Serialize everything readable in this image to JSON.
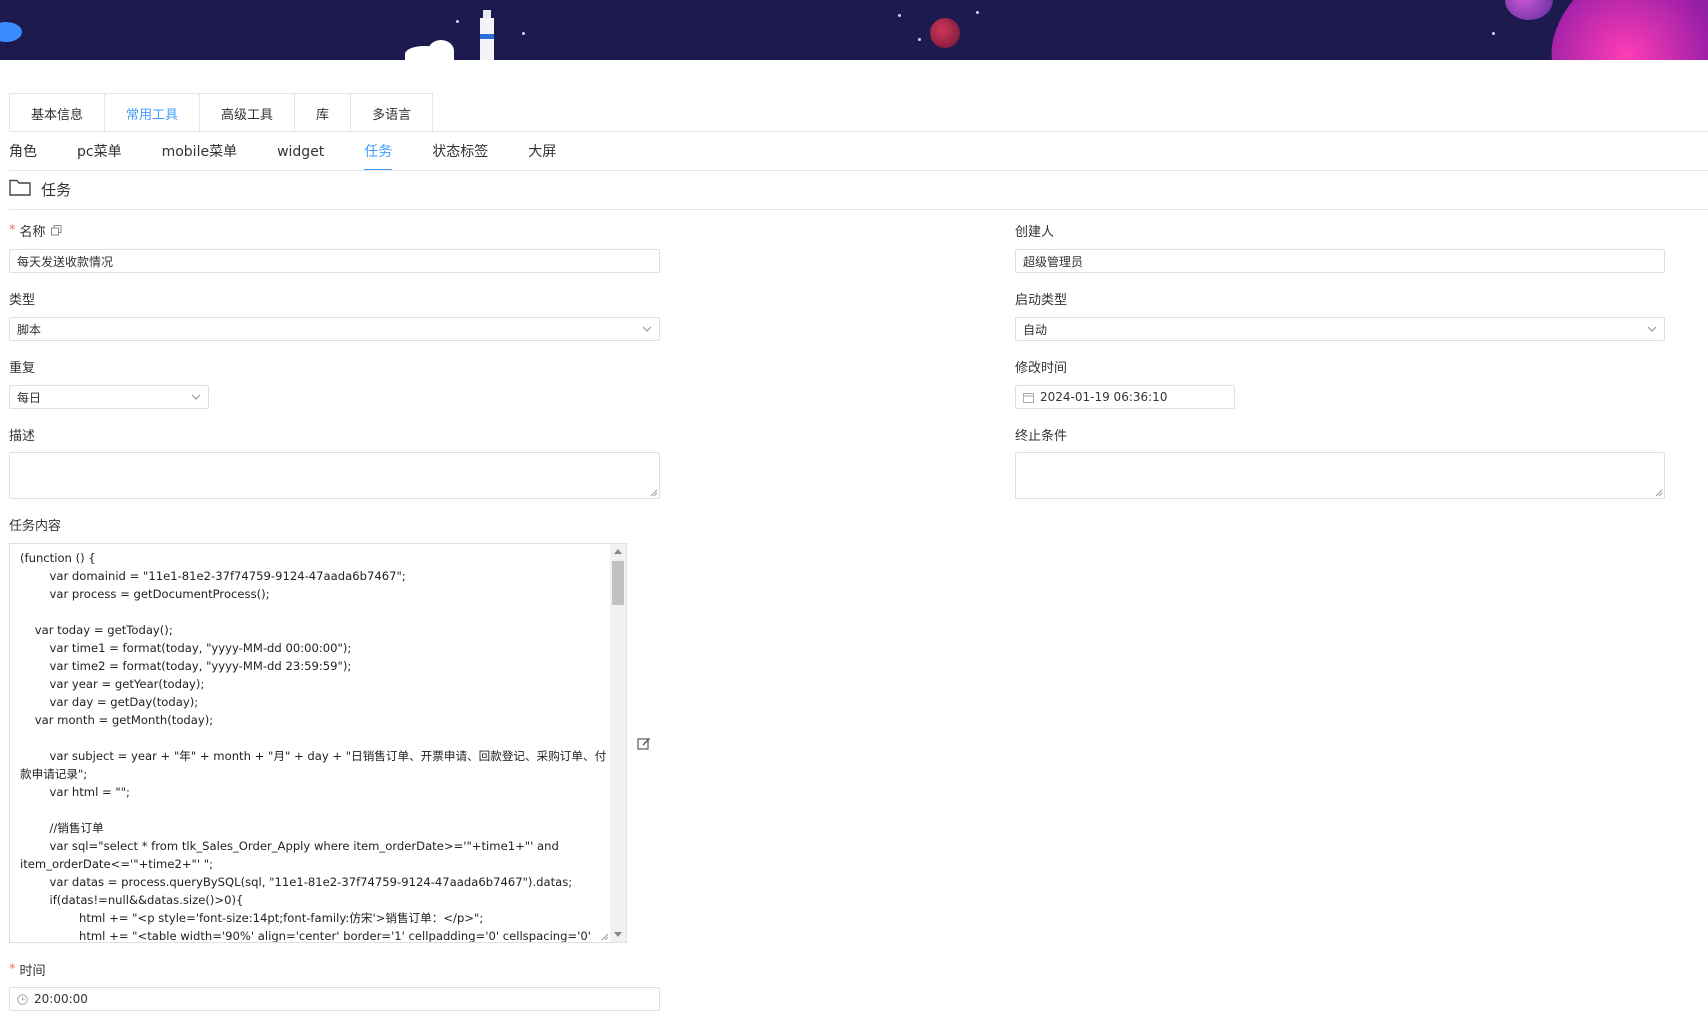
{
  "top_tabs": [
    {
      "label": "基本信息",
      "active": false
    },
    {
      "label": "常用工具",
      "active": true
    },
    {
      "label": "高级工具",
      "active": false
    },
    {
      "label": "库",
      "active": false
    },
    {
      "label": "多语言",
      "active": false
    }
  ],
  "sub_tabs": [
    {
      "label": "角色",
      "active": false
    },
    {
      "label": "pc菜单",
      "active": false
    },
    {
      "label": "mobile菜单",
      "active": false
    },
    {
      "label": "widget",
      "active": false
    },
    {
      "label": "任务",
      "active": true
    },
    {
      "label": "状态标签",
      "active": false
    },
    {
      "label": "大屏",
      "active": false
    }
  ],
  "section": {
    "title": "任务",
    "icon": "folder-icon"
  },
  "form": {
    "name_label": "名称",
    "name_value": "每天发送收款情况",
    "creator_label": "创建人",
    "creator_value": "超级管理员",
    "type_label": "类型",
    "type_value": "脚本",
    "start_type_label": "启动类型",
    "start_type_value": "自动",
    "repeat_label": "重复",
    "repeat_value": "每日",
    "modified_label": "修改时间",
    "modified_value": "2024-01-19 06:36:10",
    "desc_label": "描述",
    "desc_value": "",
    "stop_label": "终止条件",
    "stop_value": "",
    "content_label": "任务内容",
    "content_value": "(function () {\n        var domainid = \"11e1-81e2-37f74759-9124-47aada6b7467\";\n        var process = getDocumentProcess();\n\n    var today = getToday();\n        var time1 = format(today, \"yyyy-MM-dd 00:00:00\");\n        var time2 = format(today, \"yyyy-MM-dd 23:59:59\");\n        var year = getYear(today);\n        var day = getDay(today);\n    var month = getMonth(today);\n\n        var subject = year + \"年\" + month + \"月\" + day + \"日销售订单、开票申请、回款登记、采购订单、付款申请记录\";\n        var html = \"\";\n\n        //销售订单\n        var sql=\"select * from tlk_Sales_Order_Apply where item_orderDate>='\"+time1+\"' and item_orderDate<='\"+time2+\"' \";\n        var datas = process.queryBySQL(sql, \"11e1-81e2-37f74759-9124-47aada6b7467\").datas;\n        if(datas!=null&&datas.size()>0){\n                html += \"<p style='font-size:14pt;font-family:仿宋'>销售订单：</p>\";\n                html += \"<table width='90%' align='center' border='1' cellpadding='0' cellspacing='0'",
    "time_label": "时间",
    "time_value": "20:00:00"
  },
  "colors": {
    "accent": "#409eff",
    "required": "#f56c6c",
    "banner": "#1c1a4f"
  }
}
